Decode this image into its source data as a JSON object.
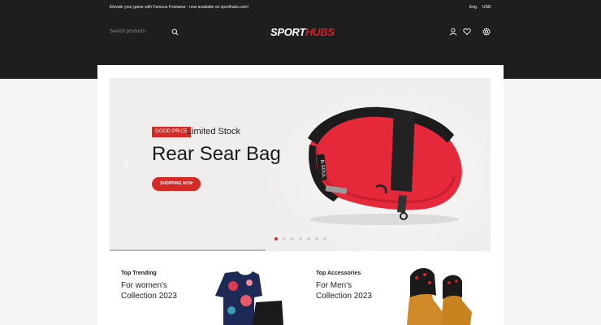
{
  "topbar": {
    "announcement": "Elevate your game with Famous Footwear - now available on sporthubs.com!",
    "language": "Eng",
    "currency": "USD"
  },
  "header": {
    "search_placeholder": "Search products",
    "logo_part1": "SPORT",
    "logo_part2": "HUBS",
    "icons": [
      "user-icon",
      "heart-icon",
      "settings-icon",
      "search-icon"
    ]
  },
  "hero": {
    "badge": "GOOD PRICE",
    "tagline": "Limited Stock",
    "title": "Rear Sear Bag",
    "cta": "SHOPPING NOW",
    "slide_count": 7,
    "active_slide": 1,
    "progress": 0.41,
    "bag_brand": "B-SOUL"
  },
  "cards": [
    {
      "label": "Top Trending",
      "line1": "For women's",
      "line2": "Collection 2023"
    },
    {
      "label": "Top Accessories",
      "line1": "For Men's",
      "line2": "Collection 2023"
    }
  ],
  "colors": {
    "accent": "#d42a28",
    "header_bg": "#1e1e1e",
    "hero_bg": "#efeeec"
  }
}
